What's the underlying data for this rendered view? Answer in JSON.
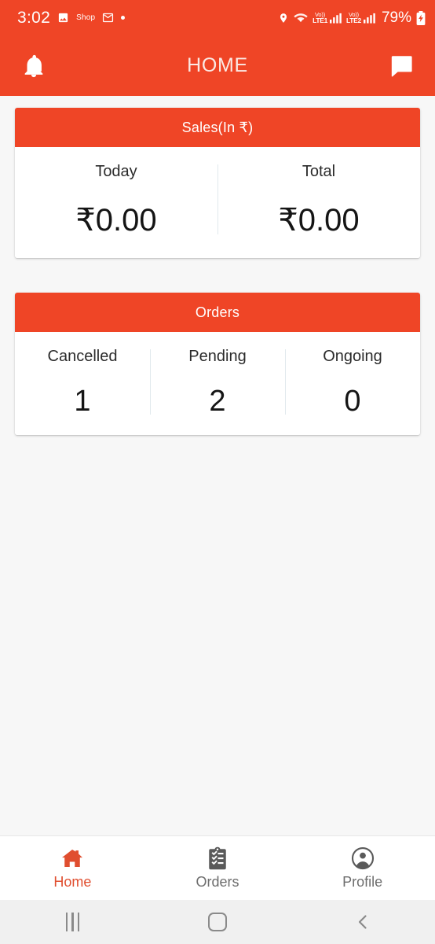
{
  "status_bar": {
    "time": "3:02",
    "battery_percent": "79%",
    "shop_label": "Shop",
    "volte1_top": "Vo))",
    "volte1_bottom": "LTE1",
    "volte2_top": "Vo))",
    "volte2_bottom": "LTE2",
    "icons": {
      "photos": "photos-icon",
      "gmail": "gmail-icon",
      "notification_dot": "notification-dot-icon",
      "location": "location-pin-icon",
      "wifi": "wifi-icon",
      "signal1": "signal-bars-icon",
      "signal2": "signal-bars-icon",
      "battery": "battery-charging-icon"
    }
  },
  "app_bar": {
    "title": "HOME",
    "left_icon": "notification-bell-icon",
    "right_icon": "chat-bubble-icon"
  },
  "theme": {
    "primary": "#ef4526",
    "background": "#f7f7f7",
    "card": "#ffffff",
    "divider": "#e1e9ed",
    "nav_active": "#e04e2f",
    "nav_inactive": "#6d6d6d"
  },
  "cards": [
    {
      "id": "sales",
      "header": "Sales(In ₹)",
      "stats": [
        {
          "label": "Today",
          "value": "₹0.00"
        },
        {
          "label": "Total",
          "value": "₹0.00"
        }
      ]
    },
    {
      "id": "orders",
      "header": "Orders",
      "stats": [
        {
          "label": "Cancelled",
          "value": "1"
        },
        {
          "label": "Pending",
          "value": "2"
        },
        {
          "label": "Ongoing",
          "value": "0"
        }
      ]
    }
  ],
  "bottom_nav": {
    "items": [
      {
        "label": "Home",
        "icon": "home-icon",
        "active": true
      },
      {
        "label": "Orders",
        "icon": "clipboard-list-icon",
        "active": false
      },
      {
        "label": "Profile",
        "icon": "person-circle-icon",
        "active": false
      }
    ]
  },
  "android_nav": {
    "recents": "recents-icon",
    "home": "home-square-icon",
    "back": "back-chevron-icon"
  }
}
